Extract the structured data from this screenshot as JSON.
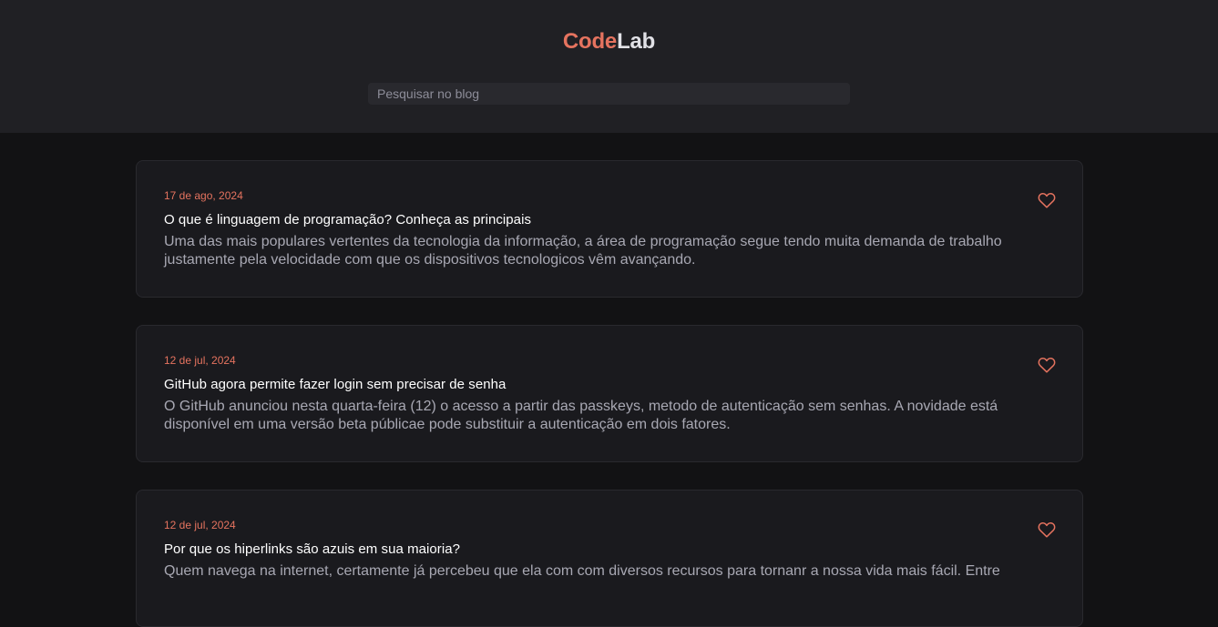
{
  "header": {
    "logo_part1": "Code",
    "logo_part2": "Lab",
    "search_placeholder": "Pesquisar no blog"
  },
  "posts": [
    {
      "date": "17 de ago, 2024",
      "title": "O que é linguagem de programação? Conheça as principais",
      "excerpt": "Uma das mais populares vertentes da tecnologia da informação, a área de programação segue tendo muita demanda de trabalho justamente pela velocidade com que os dispositivos tecnologicos vêm avançando."
    },
    {
      "date": "12 de jul, 2024",
      "title": "GitHub agora permite fazer login sem precisar de senha",
      "excerpt": "O GitHub anunciou nesta quarta-feira (12) o acesso a partir das passkeys, metodo de autenticação sem senhas. A novidade está disponível em uma versão beta públicae pode substituir a autenticação em dois fatores."
    },
    {
      "date": "12 de jul, 2024",
      "title": "Por que os hiperlinks são azuis em sua maioria?",
      "excerpt": "Quem navega na internet, certamente já percebeu que ela com com diversos recursos para tornanr a nossa vida mais fácil. Entre"
    }
  ],
  "colors": {
    "accent": "#E5735F",
    "header_bg": "#202024",
    "page_bg": "#121214",
    "card_bg": "#1A1A1E"
  },
  "icons": {
    "favorite": "heart-icon"
  }
}
